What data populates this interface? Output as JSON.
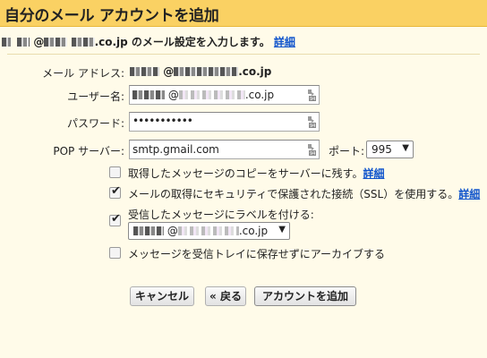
{
  "title": "自分のメール アカウントを追加",
  "intro": {
    "suffix": ".co.jp のメール設定を入力します。",
    "details_link": "詳細"
  },
  "form": {
    "email_label": "メール アドレス:",
    "email_suffix": ".co.jp",
    "username_label": "ユーザー名:",
    "username_at": "@",
    "username_suffix": ".co.jp",
    "password_label": "パスワード:",
    "password_value": "•••••••••••",
    "pop_label": "POP サーバー:",
    "pop_value": "smtp.gmail.com",
    "port_label": "ポート:",
    "port_value": "995"
  },
  "options": [
    {
      "label": "取得したメッセージのコピーをサーバーに残す。",
      "link": "詳細",
      "checked": false
    },
    {
      "label": "メールの取得にセキュリティで保護された接続（SSL）を使用する。",
      "link": "詳細",
      "checked": true
    },
    {
      "label": "受信したメッセージにラベルを付ける:",
      "link": "",
      "checked": true
    },
    {
      "label": "メッセージを受信トレイに保存せずにアーカイブする",
      "link": "",
      "checked": false
    }
  ],
  "label_select": {
    "at": "@",
    "suffix": ".co.jp"
  },
  "buttons": {
    "cancel": "キャンセル",
    "back": "« 戻る",
    "add": "アカウントを追加"
  },
  "colors": {
    "header": "#fad163",
    "background": "#fffbe9",
    "link": "#1155cc"
  }
}
